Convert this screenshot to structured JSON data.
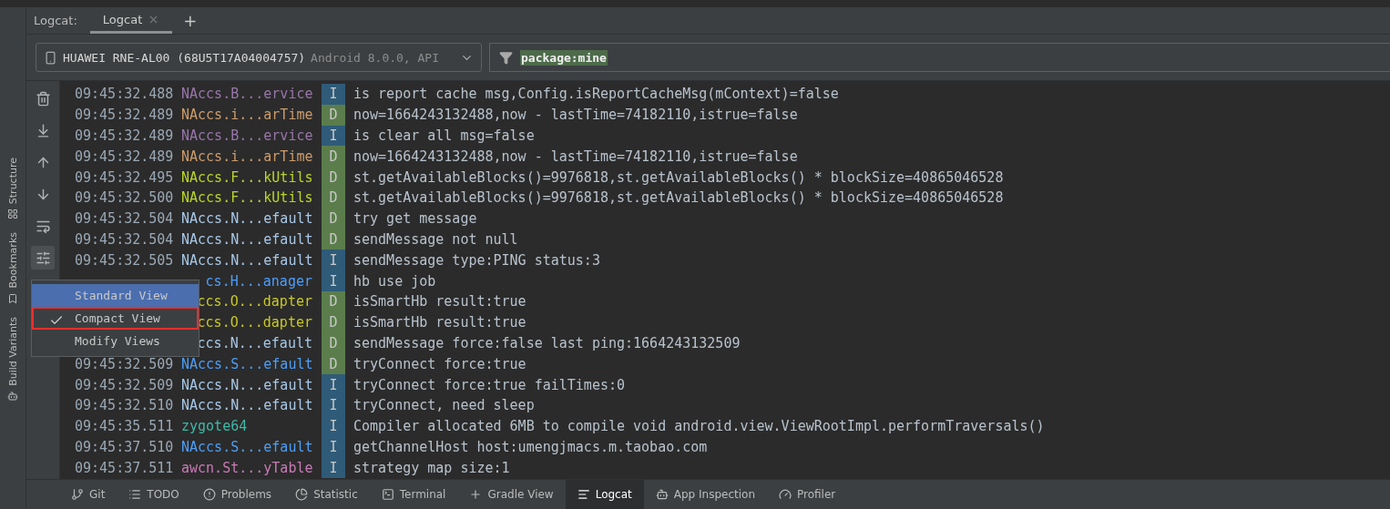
{
  "tabs_bar": {
    "label": "Logcat:",
    "tabs": [
      {
        "label": "Logcat",
        "selected": true
      }
    ],
    "add_button": "+"
  },
  "device": {
    "name": "HUAWEI RNE-AL00 (68U5T17A04004757)",
    "detail": "Android 8.0.0, API"
  },
  "filter": {
    "value": "package:mine"
  },
  "side_tools": [
    "Structure",
    "Bookmarks",
    "Build Variants"
  ],
  "log_rows": [
    {
      "time": "09:45:32.488",
      "tag": {
        "text": "NAccs.B...ervice",
        "color": "#9876aa"
      },
      "priority": {
        "text": "I",
        "color": "#2f5b78"
      },
      "message": "is report cache msg,Config.isReportCacheMsg(mContext)=false"
    },
    {
      "time": "09:45:32.489",
      "tag": {
        "text": "NAccs.i...arTime",
        "color": "#cc9c6b"
      },
      "priority": {
        "text": "D",
        "color": "#5b7d4c"
      },
      "message": "now=1664243132488,now - lastTime=74182110,istrue=false"
    },
    {
      "time": "09:45:32.489",
      "tag": {
        "text": "NAccs.B...ervice",
        "color": "#9876aa"
      },
      "priority": {
        "text": "I",
        "color": "#2f5b78"
      },
      "message": "is clear all msg=false"
    },
    {
      "time": "09:45:32.489",
      "tag": {
        "text": "NAccs.i...arTime",
        "color": "#cc9c6b"
      },
      "priority": {
        "text": "D",
        "color": "#5b7d4c"
      },
      "message": "now=1664243132488,now - lastTime=74182110,istrue=false"
    },
    {
      "time": "09:45:32.495",
      "tag": {
        "text": "NAccs.F...kUtils",
        "color": "#b9d42a"
      },
      "priority": {
        "text": "D",
        "color": "#5b7d4c"
      },
      "message": "st.getAvailableBlocks()=9976818,st.getAvailableBlocks() * blockSize=40865046528"
    },
    {
      "time": "09:45:32.500",
      "tag": {
        "text": "NAccs.F...kUtils",
        "color": "#b9d42a"
      },
      "priority": {
        "text": "D",
        "color": "#5b7d4c"
      },
      "message": "st.getAvailableBlocks()=9976818,st.getAvailableBlocks() * blockSize=40865046528"
    },
    {
      "time": "09:45:32.504",
      "tag": {
        "text": "NAccs.N...efault",
        "color": "#a7c7e7"
      },
      "priority": {
        "text": "D",
        "color": "#5b7d4c"
      },
      "message": "try get message"
    },
    {
      "time": "09:45:32.504",
      "tag": {
        "text": "NAccs.N...efault",
        "color": "#a7c7e7"
      },
      "priority": {
        "text": "D",
        "color": "#5b7d4c"
      },
      "message": "sendMessage not null"
    },
    {
      "time": "09:45:32.505",
      "tag": {
        "text": "NAccs.N...efault",
        "color": "#a7c7e7"
      },
      "priority": {
        "text": "I",
        "color": "#2f5b78"
      },
      "message": "sendMessage type:PING status:3"
    },
    {
      "tag": {
        "text": "cs.H...anager",
        "color": "#4a9eff"
      },
      "priority": {
        "text": "I",
        "color": "#2f5b78"
      },
      "message": "hb use job"
    },
    {
      "tag": {
        "text": "ccs.O...dapter",
        "color": "#c8c826"
      },
      "priority": {
        "text": "D",
        "color": "#5b7d4c"
      },
      "message": "isSmartHb result:true"
    },
    {
      "tag": {
        "text": "ccs.O...dapter",
        "color": "#c8c826"
      },
      "priority": {
        "text": "D",
        "color": "#5b7d4c"
      },
      "message": "isSmartHb result:true"
    },
    {
      "tag": {
        "text": "ccs.N...efault",
        "color": "#a7c7e7"
      },
      "priority": {
        "text": "D",
        "color": "#5b7d4c"
      },
      "message": "sendMessage force:false last ping:1664243132509"
    },
    {
      "time": "09:45:32.509",
      "tag": {
        "text": "NAccs.S...efault",
        "color": "#4e9ef5"
      },
      "priority": {
        "text": "D",
        "color": "#5b7d4c"
      },
      "message": "tryConnect force:true"
    },
    {
      "time": "09:45:32.509",
      "tag": {
        "text": "NAccs.N...efault",
        "color": "#a7c7e7"
      },
      "priority": {
        "text": "I",
        "color": "#2f5b78"
      },
      "message": "tryConnect force:true failTimes:0"
    },
    {
      "time": "09:45:32.510",
      "tag": {
        "text": "NAccs.N...efault",
        "color": "#a7c7e7"
      },
      "priority": {
        "text": "I",
        "color": "#2f5b78"
      },
      "message": "tryConnect, need sleep"
    },
    {
      "time": "09:45:35.511",
      "tag": {
        "text": "zygote64",
        "color": "#3fb8a7"
      },
      "priority": {
        "text": "I",
        "color": "#2f5b78"
      },
      "message": "Compiler allocated 6MB to compile void android.view.ViewRootImpl.performTraversals()"
    },
    {
      "time": "09:45:37.510",
      "tag": {
        "text": "NAccs.S...efault",
        "color": "#4e9ef5"
      },
      "priority": {
        "text": "I",
        "color": "#2f5b78"
      },
      "message": "getChannelHost host:umengjmacs.m.taobao.com"
    },
    {
      "time": "09:45:37.511",
      "tag": {
        "text": "awcn.St...yTable",
        "color": "#c97ab6"
      },
      "priority": {
        "text": "I",
        "color": "#2f5b78"
      },
      "message": "strategy map size:1"
    }
  ],
  "view_menu": [
    {
      "label": "Standard View",
      "selected": true,
      "checked": false,
      "outlined": false
    },
    {
      "label": "Compact View",
      "selected": false,
      "checked": true,
      "outlined": true
    },
    {
      "label": "Modify Views",
      "selected": false,
      "checked": false,
      "outlined": false
    }
  ],
  "bottom_tabs": [
    {
      "kind": "git",
      "label": "Git",
      "selected": false
    },
    {
      "kind": "todo",
      "label": "TODO",
      "selected": false
    },
    {
      "kind": "problems",
      "label": "Problems",
      "selected": false
    },
    {
      "kind": "statistic",
      "label": "Statistic",
      "selected": false
    },
    {
      "kind": "terminal",
      "label": "Terminal",
      "selected": false
    },
    {
      "kind": "gradle",
      "label": "Gradle View",
      "selected": false
    },
    {
      "kind": "logcat",
      "label": "Logcat",
      "selected": true
    },
    {
      "kind": "inspection",
      "label": "App Inspection",
      "selected": false
    },
    {
      "kind": "profiler",
      "label": "Profiler",
      "selected": false
    }
  ]
}
